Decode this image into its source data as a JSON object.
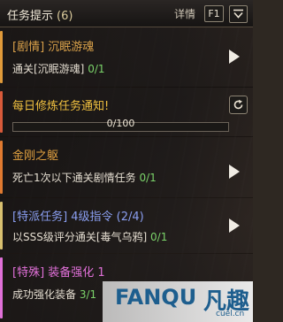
{
  "header": {
    "title": "任务提示",
    "count": "(6)",
    "detail_label": "详情",
    "hotkey": "F1"
  },
  "quests": [
    {
      "title": "[剧情] 沉眠游魂",
      "title_color": "#d9a14a",
      "desc_prefix": "通关[沉眠游魂]",
      "progress": "0/1",
      "accent_color": "#e09a3a"
    },
    {
      "title": "金刚之躯",
      "title_color": "#e0a040",
      "desc_prefix": "死亡1次以下通关剧情任务",
      "progress": "0/1",
      "accent_color": "#e07a30"
    },
    {
      "title": "[特派任务] 4级指令 (2/4)",
      "title_color": "#8a9ef0",
      "desc_prefix": "以SSS级评分通关[毒气乌鸦]",
      "progress": "0/1",
      "accent_color": "#d8c070"
    },
    {
      "title": "[特殊] 装备强化 1",
      "title_color": "#e070d8",
      "desc_prefix": "成功强化装备",
      "progress": "3/1",
      "accent_color": "#e070d8"
    }
  ],
  "daily": {
    "title": "每日修炼任务通知!",
    "title_color": "#f0c040",
    "progress_text": "0/100",
    "progress_fraction": 0.0,
    "accent_color": "#d85a3a"
  },
  "watermark": {
    "brand": "FANQU",
    "brand_cn": "凡趣",
    "url": "cuel.cn"
  }
}
